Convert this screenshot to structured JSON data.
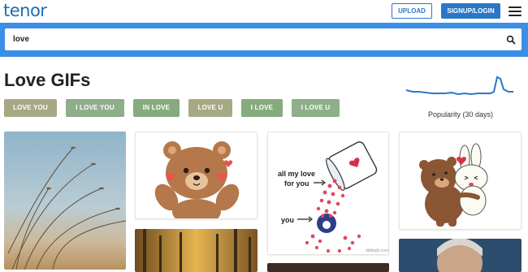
{
  "header": {
    "logo": "tenor",
    "upload_label": "UPLOAD",
    "signup_label": "SIGNUP/LOGIN"
  },
  "search": {
    "value": "love"
  },
  "page": {
    "title": "Love GIFs"
  },
  "tags": [
    {
      "label": "LOVE YOU",
      "color": "#a7a884"
    },
    {
      "label": "I LOVE YOU",
      "color": "#8fae8a"
    },
    {
      "label": "IN LOVE",
      "color": "#86ab7e"
    },
    {
      "label": "LOVE U",
      "color": "#a7a884"
    },
    {
      "label": "I LOVE",
      "color": "#86ab7e"
    },
    {
      "label": "I LOVE U",
      "color": "#8fae8a"
    }
  ],
  "popularity": {
    "label": "Popularity (30 days)",
    "color": "#2a77c8"
  },
  "gifs": {
    "card3": {
      "line1": "all my love",
      "line2": "for you",
      "line3": "you",
      "watermark": "ddidiubi.com"
    }
  },
  "colors": {
    "brand": "#1e6db3",
    "accent": "#2a77c8",
    "search_band": "#3b8fe6"
  }
}
